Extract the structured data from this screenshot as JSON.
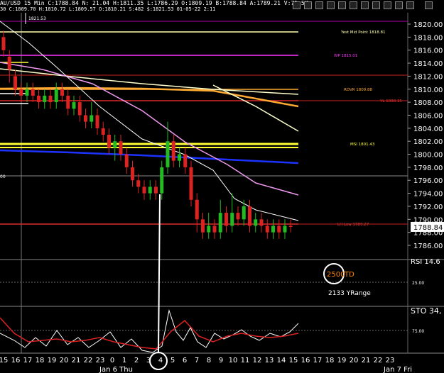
{
  "header": {
    "line1": "AU/USD  15 Min  C:1788.84  N:  21.04  H:1811.35  L:1786.29  O:1809.19  B:1788.84  A:1789.21  V:71.5K",
    "line2": "30  C:1809.70  H:1810.72  L:1809.57  O:1810.21  S:482  $:1821.53  01-05-22  2:11"
  },
  "colors": {
    "accent_price": "#ffffff",
    "yest_mid": "#ffffaa",
    "wp": "#ff33ff",
    "rdvr": "#ffaa33",
    "yl": "#ff3333",
    "msi": "#ffff33",
    "lh_low": "#ff4444",
    "sma_pink": "#ee99ee",
    "sma_yellow": "#ffffcc",
    "sma_blue": "#1e32ff",
    "sto_white": "#ffffff",
    "sto_red": "#dd2222",
    "td_marker": "#ffffff"
  },
  "price_axis": {
    "ticks": [
      "1820.00",
      "1818.00",
      "1816.00",
      "1814.00",
      "1812.00",
      "1810.00",
      "1808.00",
      "1806.00",
      "1804.00",
      "1802.00",
      "1800.00",
      "1798.00",
      "1796.00",
      "1794.00",
      "1792.00",
      "1790.00",
      "1788.00",
      "1786.00"
    ],
    "current": "1788.84",
    "left_marker": "00"
  },
  "top_left_label": "1821.53",
  "levels": [
    {
      "label": "Yest Mid Point 1818.81",
      "value": 1818.81
    },
    {
      "label": "WP 1815.01",
      "value": 1815.01
    },
    {
      "label": "RDVR 1809.88",
      "value": 1809.88
    },
    {
      "label": "YL 1808.15",
      "value": 1808.15
    },
    {
      "label": "MSI 1801.43",
      "value": 1801.43
    },
    {
      "label": "LH Low 1789.27",
      "value": 1789.27
    }
  ],
  "indicator_panel": {
    "title": "RSI 14.6",
    "td_value": "2500",
    "td_label": "TD",
    "yrange_text": "2133 YRange",
    "tick_25": "25.00"
  },
  "sto_panel": {
    "title": "STO  34,",
    "tick_75": "75.00"
  },
  "time_axis": {
    "labels": [
      "15",
      "16",
      "17",
      "18",
      "19",
      "20",
      "21",
      "22",
      "23",
      "0",
      "1",
      "2",
      "3",
      "4",
      "5",
      "6",
      "7",
      "8",
      "9",
      "10",
      "11",
      "12",
      "13",
      "14",
      "15",
      "16",
      "17",
      "18",
      "19",
      "20",
      "21",
      "22",
      "23",
      "0"
    ],
    "day_labels": [
      "Jan 6 Thu",
      "Jan 7 Fri"
    ],
    "circled": "5"
  },
  "chart_data": {
    "type": "candlestick",
    "title": "AU/USD 15 Min",
    "ylim": [
      1785,
      1821
    ],
    "candles": [
      [
        1818,
        1816,
        1819,
        1815
      ],
      [
        1815,
        1813,
        1816,
        1811
      ],
      [
        1812,
        1810,
        1813,
        1809
      ],
      [
        1810,
        1809,
        1811,
        1808
      ],
      [
        1809,
        1810,
        1811,
        1808
      ],
      [
        1810,
        1809,
        1811,
        1808
      ],
      [
        1809,
        1808,
        1810,
        1807
      ],
      [
        1808,
        1809,
        1810,
        1807
      ],
      [
        1809,
        1808,
        1810,
        1807
      ],
      [
        1808,
        1810,
        1811,
        1807
      ],
      [
        1810,
        1809,
        1811,
        1808
      ],
      [
        1809,
        1807,
        1810,
        1806
      ],
      [
        1807,
        1808,
        1809,
        1806
      ],
      [
        1808,
        1806,
        1809,
        1805
      ],
      [
        1806,
        1805,
        1807,
        1804
      ],
      [
        1805,
        1806,
        1808,
        1804
      ],
      [
        1806,
        1804,
        1807,
        1803
      ],
      [
        1804,
        1803,
        1805,
        1802
      ],
      [
        1803,
        1801,
        1804,
        1800
      ],
      [
        1801,
        1802,
        1803,
        1799
      ],
      [
        1802,
        1800,
        1803,
        1799
      ],
      [
        1800,
        1798,
        1801,
        1797
      ],
      [
        1798,
        1796,
        1799,
        1795
      ],
      [
        1796,
        1795,
        1797,
        1794
      ],
      [
        1795,
        1794,
        1796,
        1793
      ],
      [
        1794,
        1795,
        1796,
        1793
      ],
      [
        1795,
        1794,
        1796,
        1793
      ],
      [
        1794,
        1798,
        1799,
        1793
      ],
      [
        1798,
        1802,
        1805,
        1797
      ],
      [
        1802,
        1799,
        1803,
        1798
      ],
      [
        1799,
        1800,
        1801,
        1798
      ],
      [
        1800,
        1798,
        1801,
        1797
      ],
      [
        1798,
        1793,
        1799,
        1792
      ],
      [
        1793,
        1790,
        1794,
        1788
      ],
      [
        1790,
        1788,
        1791,
        1787
      ],
      [
        1788,
        1789,
        1791,
        1787
      ],
      [
        1789,
        1788,
        1790,
        1787
      ],
      [
        1788,
        1791,
        1793,
        1787
      ],
      [
        1791,
        1789,
        1792,
        1788
      ],
      [
        1789,
        1791,
        1794,
        1788
      ],
      [
        1791,
        1790,
        1792,
        1789
      ],
      [
        1790,
        1792,
        1793,
        1789
      ],
      [
        1792,
        1789,
        1793,
        1788
      ],
      [
        1789,
        1790,
        1791,
        1788
      ],
      [
        1790,
        1789,
        1791,
        1788
      ],
      [
        1789,
        1788,
        1790,
        1787
      ],
      [
        1788,
        1789,
        1790,
        1787
      ],
      [
        1789,
        1788,
        1790,
        1787
      ],
      [
        1788,
        1789,
        1790,
        1787
      ],
      [
        1789,
        1788.84,
        1790,
        1788
      ]
    ]
  }
}
